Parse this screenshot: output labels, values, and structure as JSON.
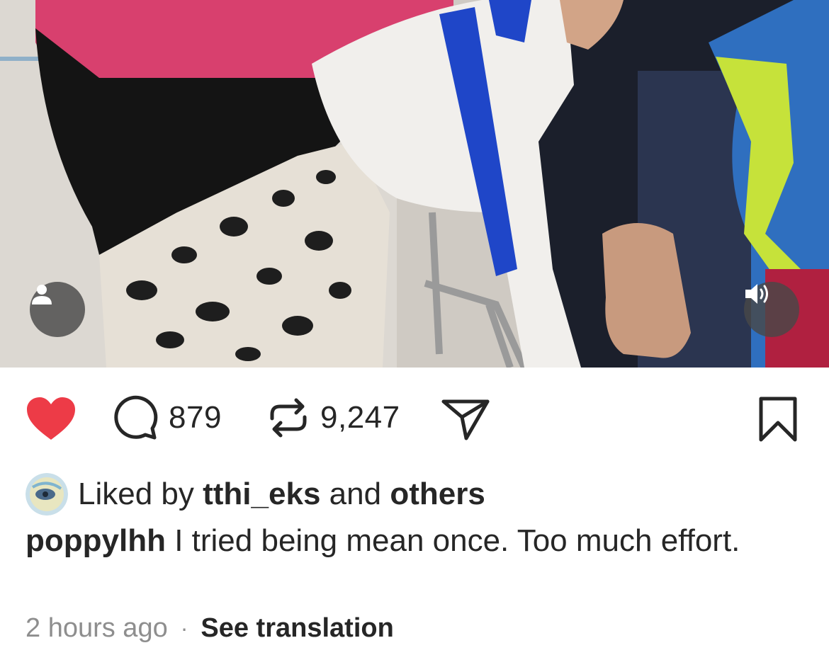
{
  "post": {
    "comment_count": "879",
    "repost_count": "9,247",
    "liked_by_prefix": "Liked by",
    "liked_by_user": "tthi_eks",
    "liked_by_connector": "and",
    "liked_by_others": "others",
    "caption_username": "poppylhh",
    "caption_text": "I tried being mean once. Too much effort.",
    "timestamp": "2 hours ago",
    "separator": "·",
    "see_translation": "See translation"
  },
  "icons": {
    "like": "heart-filled-icon",
    "comment": "speech-bubble-icon",
    "repost": "repost-arrows-icon",
    "share": "paper-plane-icon",
    "save": "bookmark-icon",
    "user": "user-tag-icon",
    "sound": "speaker-icon"
  },
  "colors": {
    "like_red": "#ed3b47",
    "text": "#262626",
    "muted": "#8e8e8e"
  }
}
